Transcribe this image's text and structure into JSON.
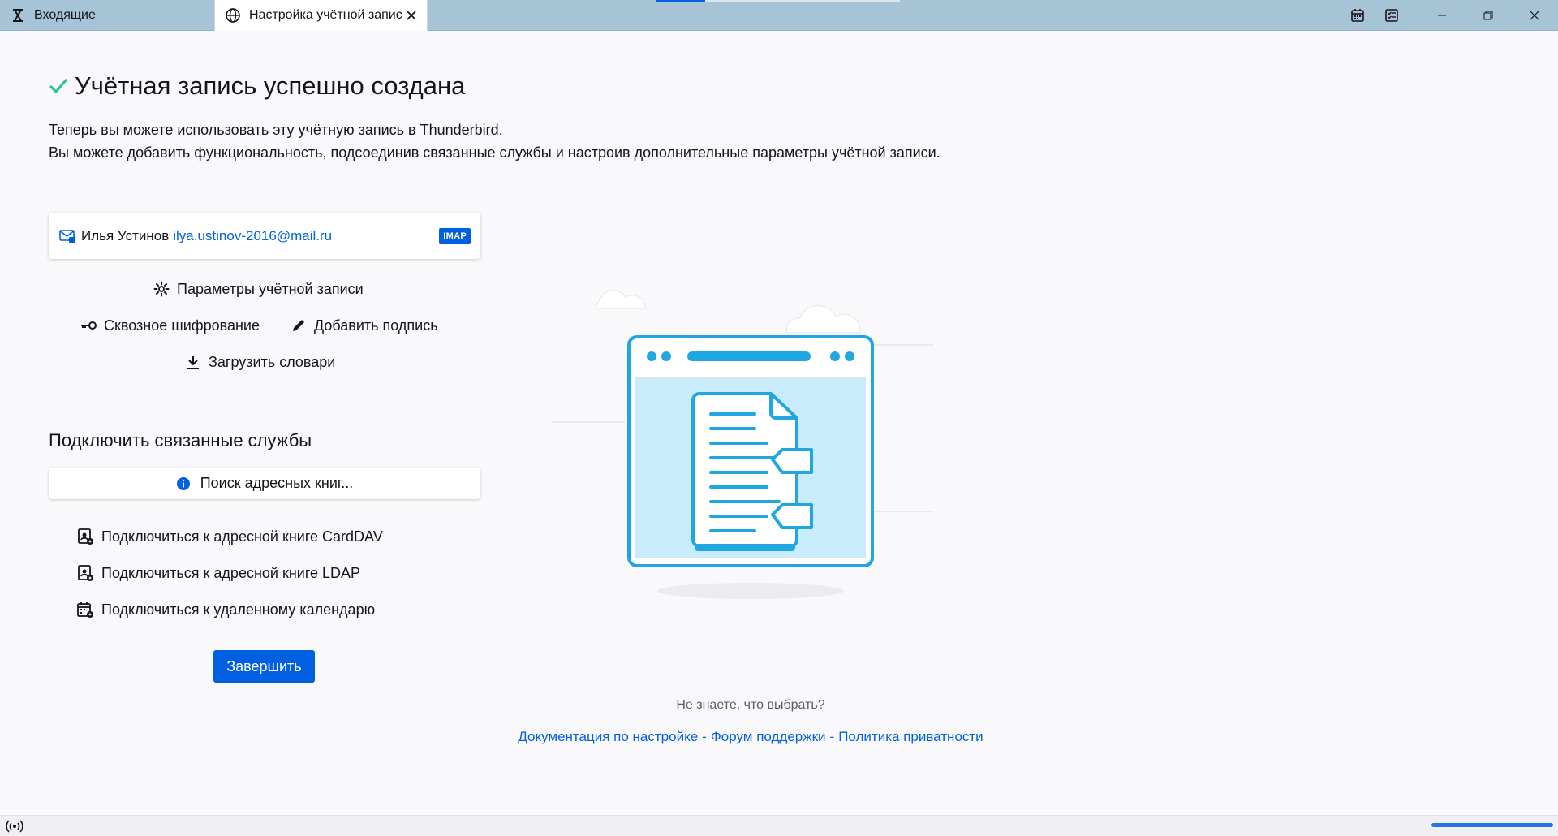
{
  "tabs": [
    {
      "label": "Входящие",
      "icon": "thunderbird-icon",
      "active": false
    },
    {
      "label": "Настройка учётной записи",
      "icon": "globe-icon",
      "active": true
    }
  ],
  "window_controls": {
    "calendar_icon": "calendar-icon",
    "tasks_icon": "tasks-icon",
    "minimize": "minimize-icon",
    "restore": "restore-icon",
    "close": "close-icon"
  },
  "page": {
    "title": "Учётная запись успешно создана",
    "intro_line1": "Теперь вы можете использовать эту учётную запись в Thunderbird.",
    "intro_line2": "Вы можете добавить функциональность, подсоединив связанные службы и настроив дополнительные параметры учётной записи."
  },
  "account": {
    "name": "Илья Устинов",
    "email": "ilya.ustinov-2016@mail.ru",
    "badge": "IMAP"
  },
  "actions": {
    "settings": "Параметры учётной записи",
    "e2e": "Сквозное шифрование",
    "signature": "Добавить подпись",
    "dictionaries": "Загрузить словари"
  },
  "services": {
    "title": "Подключить связанные службы",
    "search_button": "Поиск адресных книг...",
    "carddav": "Подключиться к адресной книге CardDAV",
    "ldap": "Подключиться к адресной книге LDAP",
    "calendar": "Подключиться к удаленному календарю"
  },
  "finish_button": "Завершить",
  "help": {
    "question": "Не знаете, что выбрать?",
    "docs": "Документация по настройке",
    "forum": "Форум поддержки",
    "privacy": "Политика приватности",
    "separator": "-"
  },
  "colors": {
    "accent": "#0060df",
    "titlebar": "#a6c4d6",
    "success": "#2ac3a2"
  }
}
